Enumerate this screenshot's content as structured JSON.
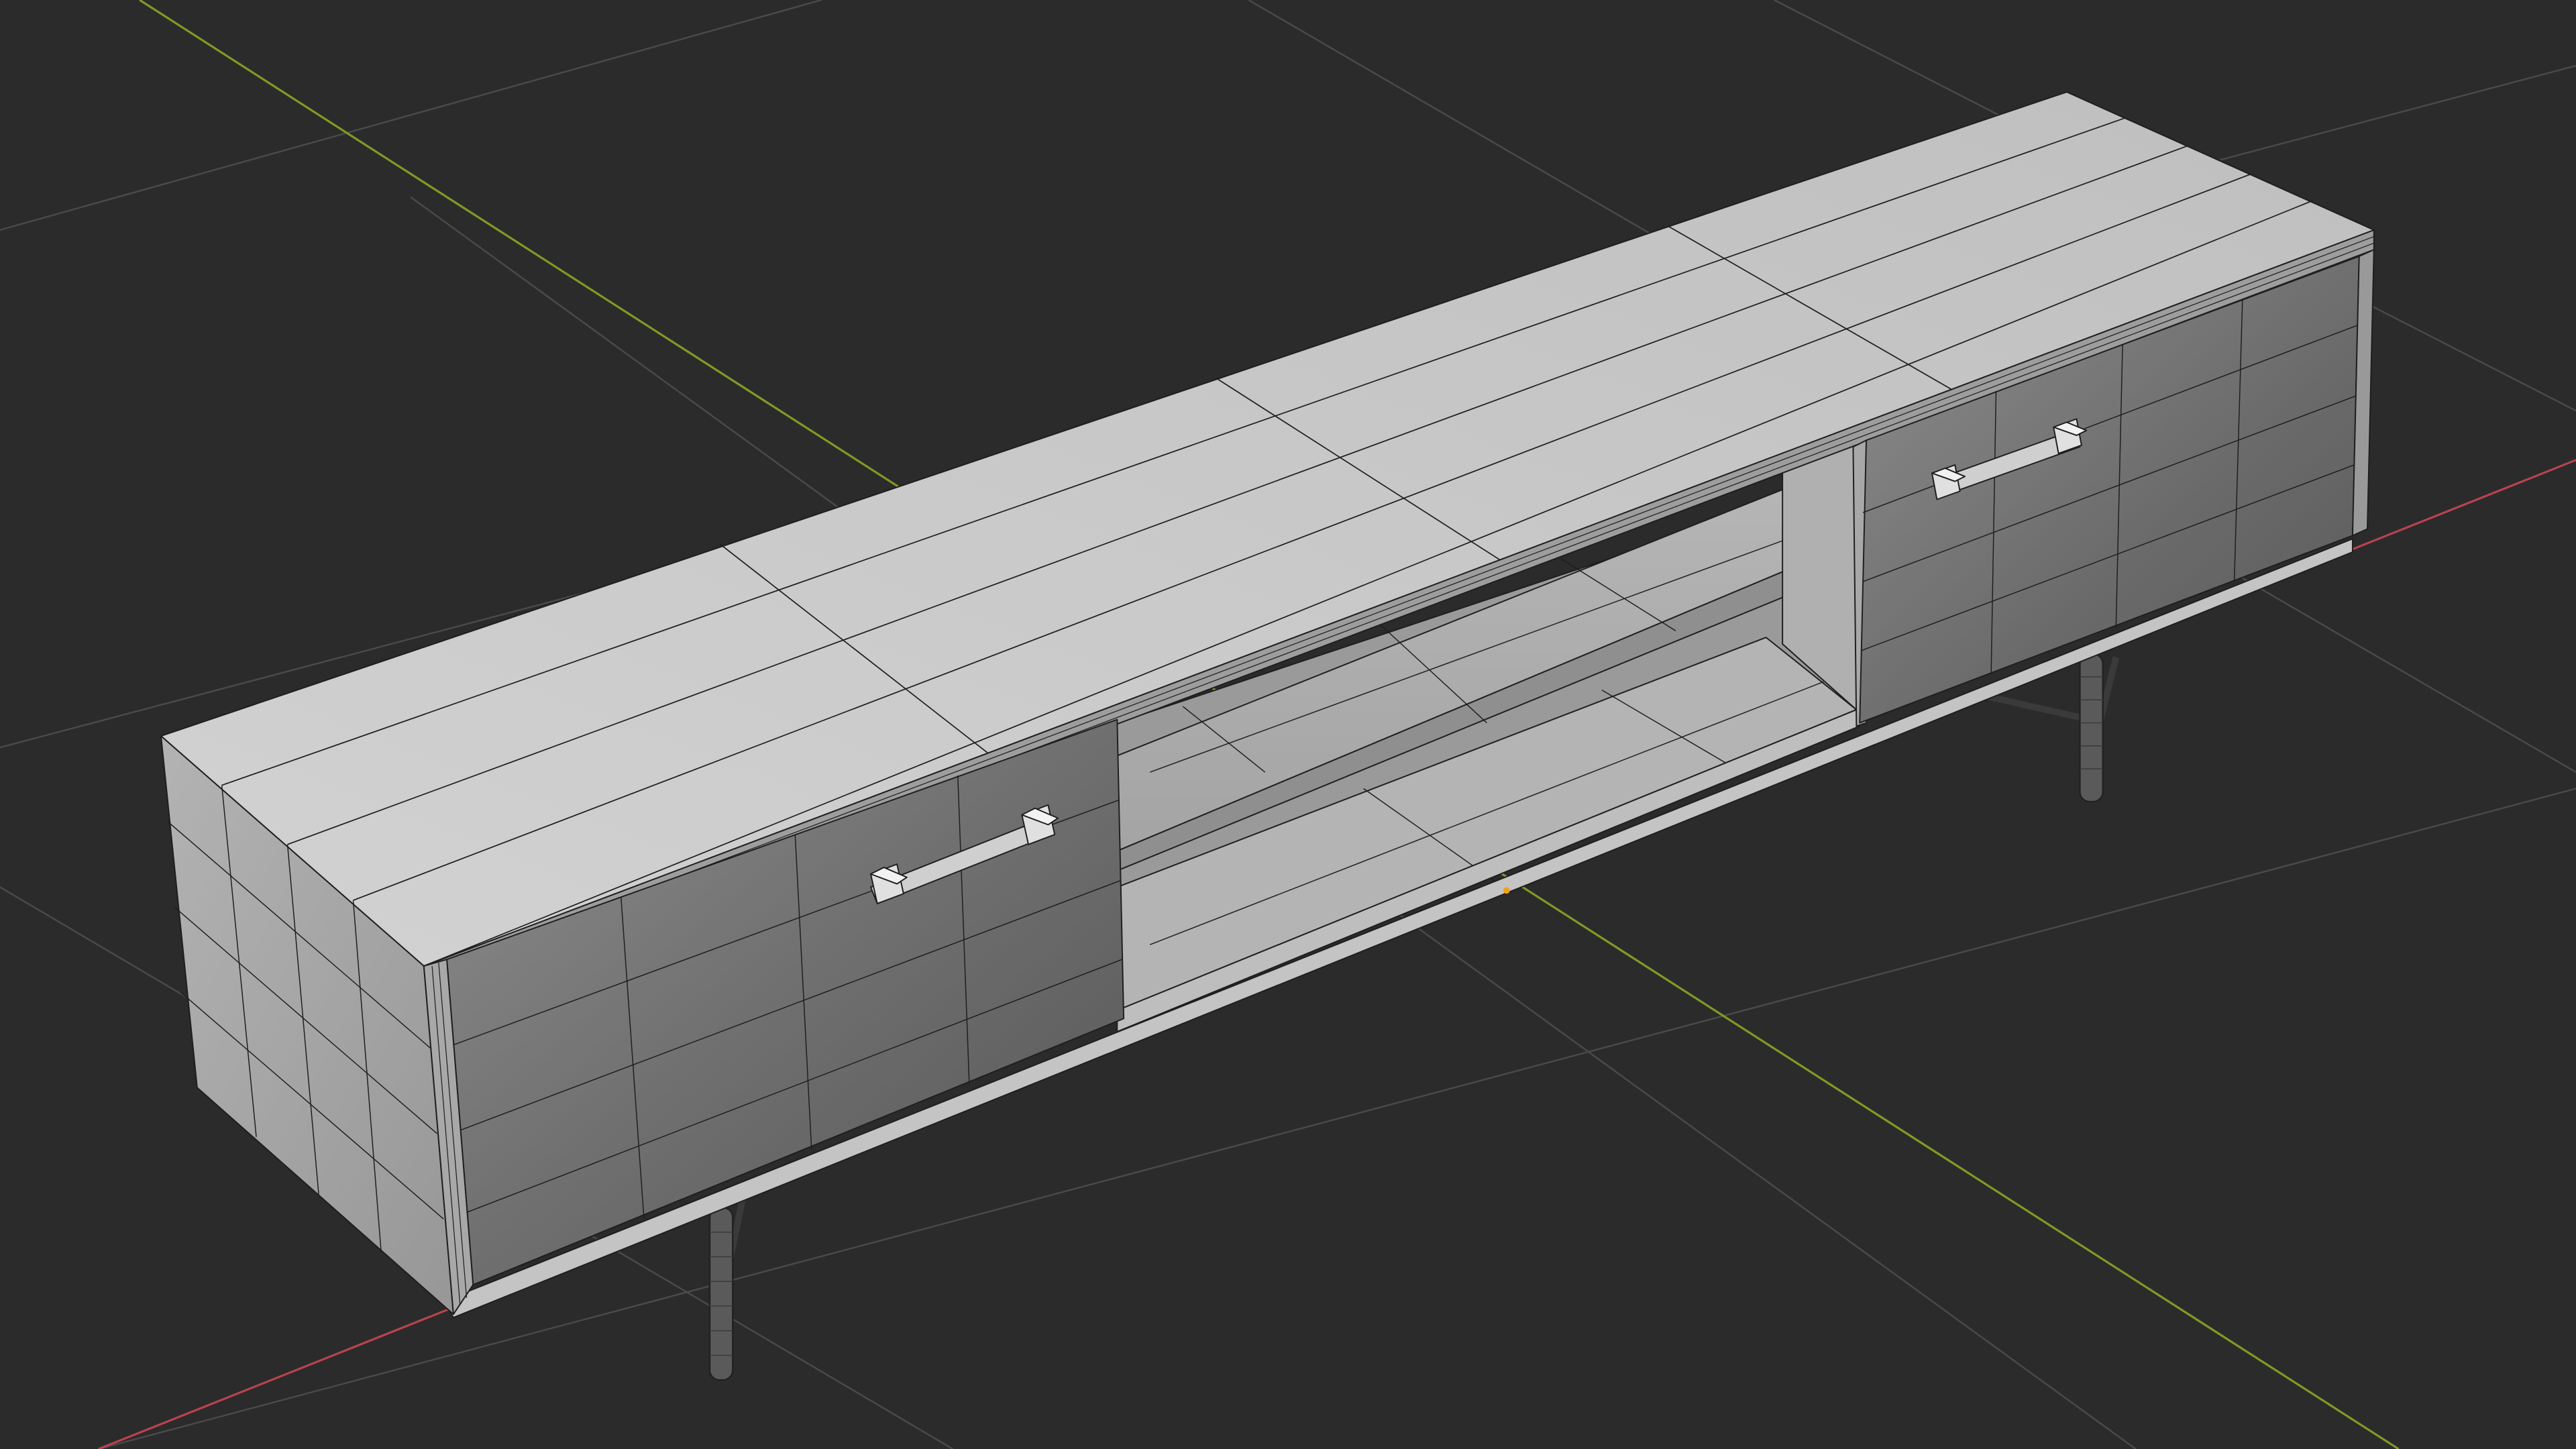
{
  "viewport": {
    "background": "#2b2b2b",
    "grid_color": "#4a4a4a",
    "x_axis_color": "#b8434f",
    "y_axis_color": "#7f9b25",
    "origin_color": "#f0a020",
    "model_fill_top": "#c9c9c9",
    "model_fill_front": "#bcbcbc",
    "model_fill_side": "#a3a3a3",
    "door_fill": "#7a7a7a",
    "wire_color": "#1e1e1e",
    "leg_color": "#555555"
  },
  "objects": {
    "model": "tv-stand-icon",
    "left_door_handle": "handle-icon",
    "right_door_handle": "handle-icon"
  }
}
